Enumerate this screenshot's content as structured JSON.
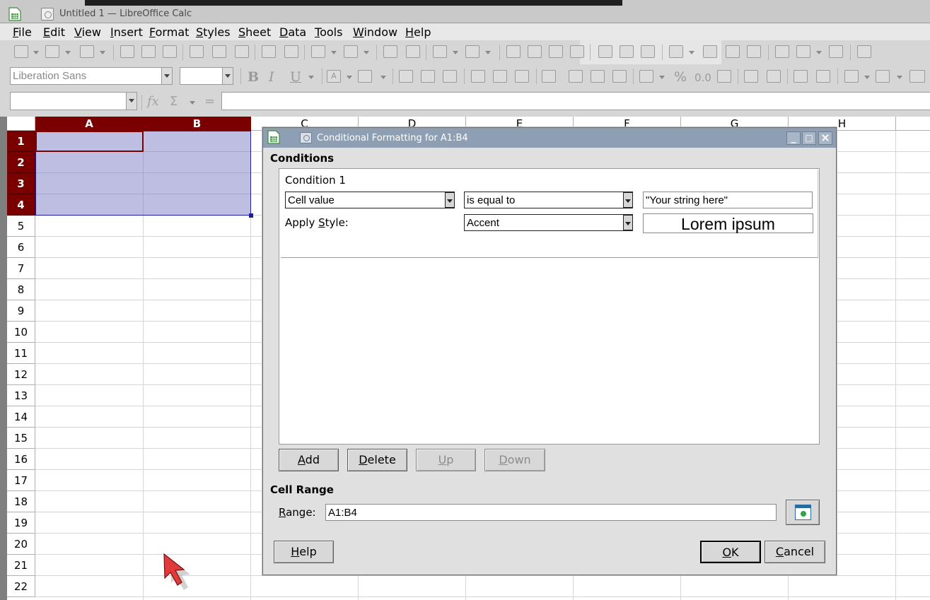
{
  "window": {
    "title": "Untitled 1 — LibreOffice Calc"
  },
  "menu": [
    {
      "label": "File",
      "underline": "F",
      "rest": "ile"
    },
    {
      "label": "Edit",
      "underline": "E",
      "rest": "dit"
    },
    {
      "label": "View",
      "underline": "V",
      "rest": "iew"
    },
    {
      "label": "Insert",
      "underline": "I",
      "rest": "nsert"
    },
    {
      "label": "Format",
      "underline": "F",
      "rest": "ormat"
    },
    {
      "label": "Styles",
      "underline": "S",
      "rest": "tyles"
    },
    {
      "label": "Sheet",
      "underline": "S",
      "rest": "heet"
    },
    {
      "label": "Data",
      "underline": "D",
      "rest": "ata"
    },
    {
      "label": "Tools",
      "underline": "T",
      "rest": "ools"
    },
    {
      "label": "Window",
      "underline": "W",
      "rest": "indow"
    },
    {
      "label": "Help",
      "underline": "H",
      "rest": "elp"
    }
  ],
  "formatting": {
    "font_name": "Liberation Sans",
    "font_size": "",
    "glyphs": {
      "bold": "B",
      "italic": "I",
      "underline": "U",
      "percent": "%",
      "decimal": "0.0"
    }
  },
  "formula_bar": {
    "name_box": "",
    "formula": "",
    "glyphs": {
      "function": "fx",
      "sum": "Σ",
      "equals": "="
    }
  },
  "sheet": {
    "columns": [
      "A",
      "B",
      "C",
      "D",
      "E",
      "F",
      "G",
      "H"
    ],
    "selected_columns": [
      "A",
      "B"
    ],
    "rows": [
      "1",
      "2",
      "3",
      "4",
      "5",
      "6",
      "7",
      "8",
      "9",
      "10",
      "11",
      "12",
      "13",
      "14",
      "15",
      "16",
      "17",
      "18",
      "19",
      "20",
      "21",
      "22"
    ],
    "selected_rows": [
      "1",
      "2",
      "3",
      "4"
    ]
  },
  "dialog": {
    "title": "Conditional Formatting for A1:B4",
    "conditions_heading": "Conditions",
    "condition": {
      "name": "Condition 1",
      "type": "Cell value",
      "operator": "is equal to",
      "value": "\"Your string here\"",
      "apply_style_label": "Apply ",
      "apply_style_underline": "S",
      "apply_style_rest": "tyle:",
      "style": "Accent",
      "preview": "Lorem ipsum"
    },
    "buttons": {
      "add": {
        "u": "A",
        "rest": "dd"
      },
      "delete": {
        "u": "D",
        "rest": "elete"
      },
      "up": {
        "u": "U",
        "rest": "p"
      },
      "down": {
        "u": "D",
        "rest": "own"
      },
      "help": {
        "u": "H",
        "rest": "elp"
      },
      "ok": {
        "u": "O",
        "rest": "K"
      },
      "cancel": {
        "u": "C",
        "rest": "ancel"
      }
    },
    "cell_range_heading": "Cell Range",
    "range_label_u": "R",
    "range_label_rest": "ange:",
    "range_value": "A1:B4",
    "window_buttons": {
      "minimize": "_",
      "maximize": "□",
      "close": "×"
    }
  },
  "colors": {
    "selected_header": "#7a0000",
    "selection_fill": "#6e6ebe",
    "dialog_title": "#8e9fb4"
  }
}
